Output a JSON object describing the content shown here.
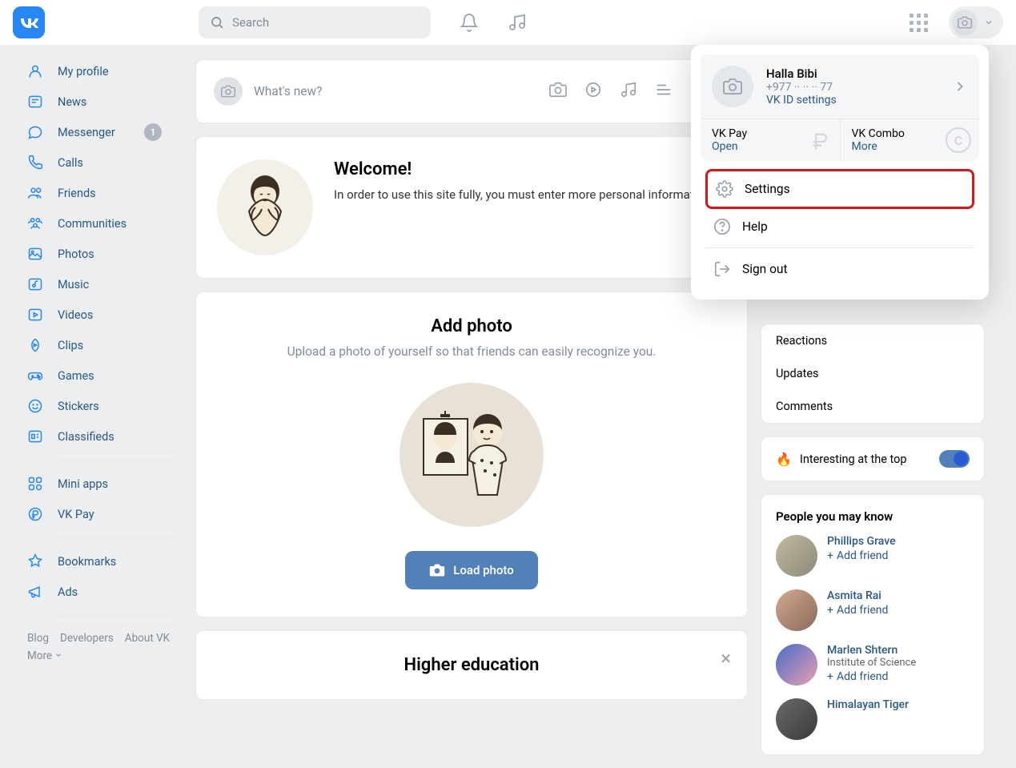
{
  "header": {
    "search_placeholder": "Search"
  },
  "nav": {
    "items": [
      "My profile",
      "News",
      "Messenger",
      "Calls",
      "Friends",
      "Communities",
      "Photos",
      "Music",
      "Videos",
      "Clips",
      "Games",
      "Stickers",
      "Classifieds"
    ],
    "messenger_badge": "1",
    "secondary": [
      "Mini apps",
      "VK Pay"
    ],
    "tertiary": [
      "Bookmarks",
      "Ads"
    ]
  },
  "footer": {
    "blog": "Blog",
    "developers": "Developers",
    "about": "About VK",
    "more": "More"
  },
  "compose": {
    "placeholder": "What's new?"
  },
  "welcome": {
    "title": "Welcome!",
    "body": "In order to use this site fully, you must enter more personal information."
  },
  "addphoto": {
    "title": "Add photo",
    "body": "Upload a photo of yourself so that friends can easily recognize you.",
    "button": "Load photo"
  },
  "highered": {
    "title": "Higher education"
  },
  "rc": {
    "reactions": "Reactions",
    "updates": "Updates",
    "comments": "Comments",
    "interesting": "Interesting at the top"
  },
  "people": {
    "title": "People you may know",
    "add": "Add friend",
    "list": [
      {
        "name": "Phillips Grave",
        "sub": ""
      },
      {
        "name": "Asmita Rai",
        "sub": ""
      },
      {
        "name": "Marlen Shtern",
        "sub": "Institute of Science"
      },
      {
        "name": "Himalayan Tiger",
        "sub": ""
      }
    ]
  },
  "dropdown": {
    "name": "Halla Bibi",
    "phone": "+977 ·· ·· ·· 77",
    "vkid": "VK ID settings",
    "pay_label": "VK Pay",
    "pay_action": "Open",
    "combo_label": "VK Combo",
    "combo_action": "More",
    "settings": "Settings",
    "help": "Help",
    "signout": "Sign out"
  }
}
